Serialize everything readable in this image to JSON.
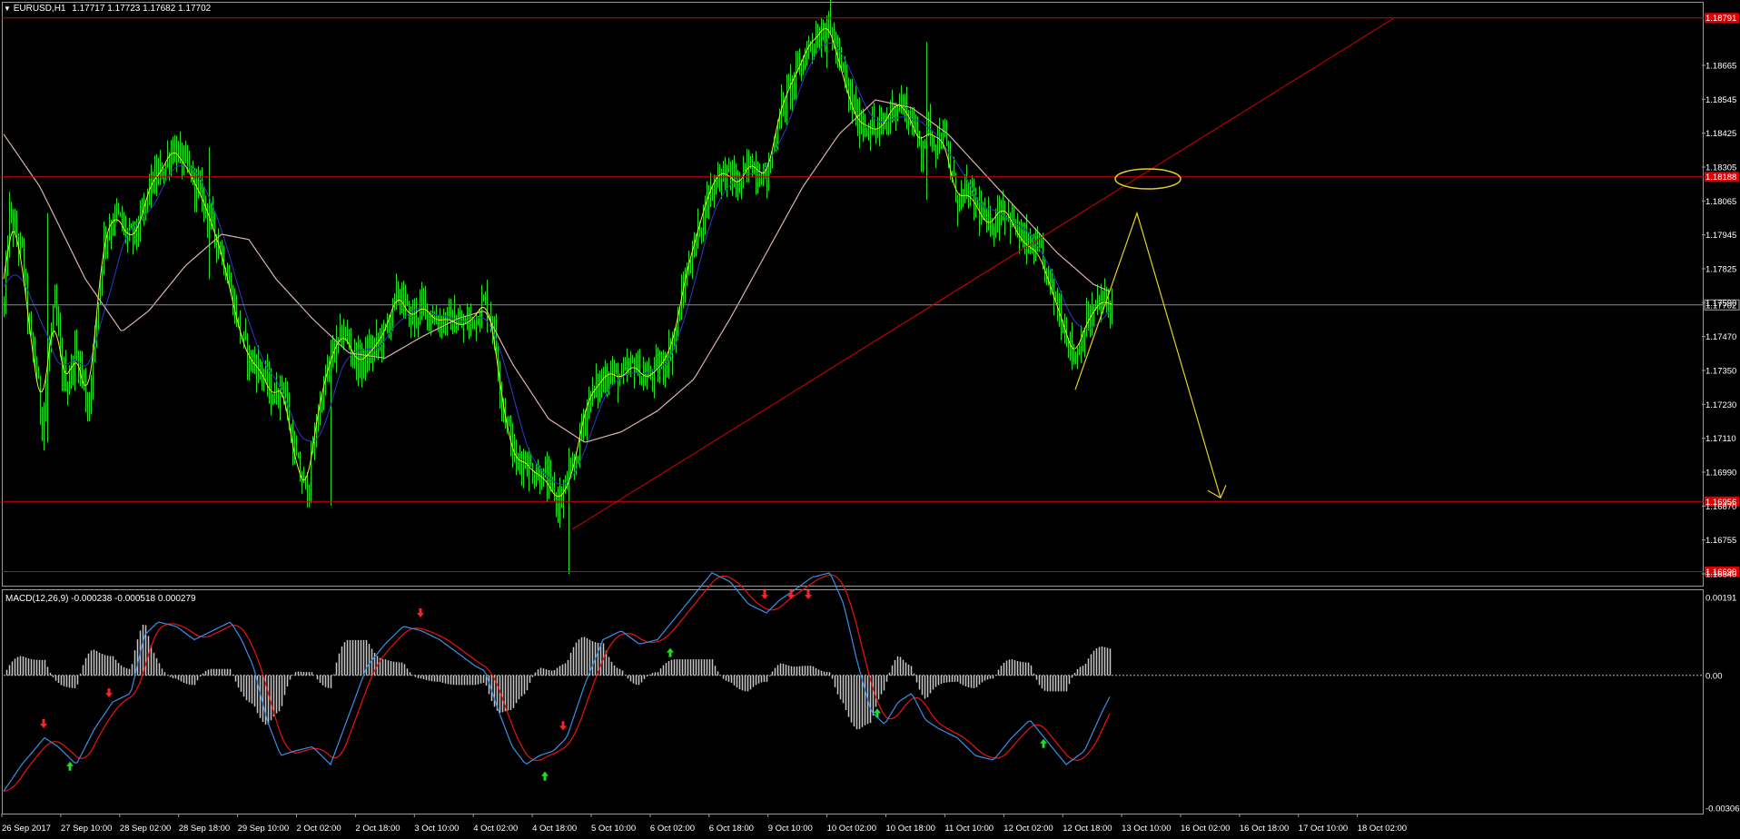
{
  "header": {
    "symbol": "EURUSD,H1",
    "ohlc": "1.17717 1.17723 1.17682 1.17702",
    "macd_label": "MACD(12,26,9) -0.000238 -0.000518 0.000279"
  },
  "colors": {
    "background": "#000000",
    "candles": "#22dd22",
    "fast_ma": "#f2ea3a",
    "mid_ma": "#2b3bcc",
    "slow_ma": "#d9b3a8",
    "levels": "#dd0000",
    "annotation": "#e6d21a",
    "macd_line": "#3b8eea",
    "signal_line": "#ee1111",
    "histogram": "#c8c8c8",
    "buy_arrow": "#22dd22",
    "sell_arrow": "#ff2222"
  },
  "chart_data": [
    {
      "type": "candlestick",
      "title": "EURUSD,H1",
      "ylim": [
        1.1664,
        1.1879
      ],
      "price_ticks": [
        "1.18665",
        "1.18545",
        "1.18425",
        "1.18305",
        "1.18065",
        "1.17945",
        "1.17825",
        "1.17590",
        "1.17470",
        "1.17350",
        "1.17230",
        "1.17110",
        "1.16990",
        "1.16870",
        "1.16755",
        "1.16640"
      ],
      "time_labels": [
        "26 Sep 2017",
        "27 Sep 10:00",
        "28 Sep 02:00",
        "28 Sep 18:00",
        "29 Sep 10:00",
        "2 Oct 02:00",
        "2 Oct 18:00",
        "3 Oct 10:00",
        "4 Oct 02:00",
        "4 Oct 18:00",
        "5 Oct 10:00",
        "6 Oct 02:00",
        "6 Oct 18:00",
        "9 Oct 10:00",
        "10 Oct 02:00",
        "10 Oct 18:00",
        "11 Oct 10:00",
        "12 Oct 02:00",
        "12 Oct 18:00",
        "13 Oct 10:00",
        "16 Oct 02:00",
        "16 Oct 18:00",
        "17 Oct 10:00",
        "18 Oct 02:00"
      ],
      "price_path": [
        [
          0,
          1.177
        ],
        [
          6,
          1.1805
        ],
        [
          14,
          1.1795
        ],
        [
          20,
          1.179
        ],
        [
          28,
          1.176
        ],
        [
          36,
          1.1745
        ],
        [
          42,
          1.1725
        ],
        [
          50,
          1.1755
        ],
        [
          56,
          1.177
        ],
        [
          64,
          1.1745
        ],
        [
          70,
          1.174
        ],
        [
          78,
          1.1752
        ],
        [
          86,
          1.1745
        ],
        [
          92,
          1.173
        ],
        [
          98,
          1.175
        ],
        [
          110,
          1.1795
        ],
        [
          124,
          1.1805
        ],
        [
          138,
          1.1795
        ],
        [
          150,
          1.18
        ],
        [
          160,
          1.1815
        ],
        [
          176,
          1.1822
        ],
        [
          186,
          1.183
        ],
        [
          196,
          1.1825
        ],
        [
          206,
          1.182
        ],
        [
          212,
          1.1815
        ],
        [
          220,
          1.181
        ],
        [
          230,
          1.18
        ],
        [
          240,
          1.179
        ],
        [
          250,
          1.1775
        ],
        [
          260,
          1.176
        ],
        [
          270,
          1.175
        ],
        [
          284,
          1.1745
        ],
        [
          296,
          1.1735
        ],
        [
          308,
          1.174
        ],
        [
          316,
          1.172
        ],
        [
          326,
          1.1705
        ],
        [
          334,
          1.17
        ],
        [
          346,
          1.173
        ],
        [
          360,
          1.175
        ],
        [
          374,
          1.176
        ],
        [
          390,
          1.1748
        ],
        [
          404,
          1.1752
        ],
        [
          420,
          1.176
        ],
        [
          434,
          1.1775
        ],
        [
          448,
          1.1765
        ],
        [
          462,
          1.177
        ],
        [
          476,
          1.1764
        ],
        [
          490,
          1.1765
        ],
        [
          504,
          1.1762
        ],
        [
          518,
          1.1765
        ],
        [
          530,
          1.1772
        ],
        [
          540,
          1.176
        ],
        [
          548,
          1.1735
        ],
        [
          556,
          1.1722
        ],
        [
          564,
          1.171
        ],
        [
          572,
          1.1712
        ],
        [
          582,
          1.1707
        ],
        [
          594,
          1.1705
        ],
        [
          604,
          1.17
        ],
        [
          610,
          1.1695
        ],
        [
          618,
          1.17
        ],
        [
          626,
          1.1705
        ],
        [
          634,
          1.172
        ],
        [
          644,
          1.1735
        ],
        [
          656,
          1.174
        ],
        [
          666,
          1.1745
        ],
        [
          680,
          1.1742
        ],
        [
          694,
          1.1748
        ],
        [
          706,
          1.1742
        ],
        [
          718,
          1.1745
        ],
        [
          730,
          1.175
        ],
        [
          740,
          1.176
        ],
        [
          750,
          1.178
        ],
        [
          762,
          1.1795
        ],
        [
          774,
          1.181
        ],
        [
          786,
          1.182
        ],
        [
          798,
          1.182
        ],
        [
          810,
          1.1815
        ],
        [
          822,
          1.1825
        ],
        [
          832,
          1.182
        ],
        [
          842,
          1.182
        ],
        [
          852,
          1.184
        ],
        [
          864,
          1.1852
        ],
        [
          876,
          1.186
        ],
        [
          888,
          1.187
        ],
        [
          898,
          1.1872
        ],
        [
          906,
          1.1878
        ],
        [
          914,
          1.187
        ],
        [
          922,
          1.186
        ],
        [
          930,
          1.185
        ],
        [
          940,
          1.184
        ],
        [
          952,
          1.1838
        ],
        [
          962,
          1.1836
        ],
        [
          972,
          1.184
        ],
        [
          982,
          1.1847
        ],
        [
          992,
          1.1845
        ],
        [
          1002,
          1.1838
        ],
        [
          1010,
          1.183
        ],
        [
          1018,
          1.1838
        ],
        [
          1026,
          1.1832
        ],
        [
          1034,
          1.1835
        ],
        [
          1042,
          1.1822
        ],
        [
          1050,
          1.181
        ],
        [
          1060,
          1.1813
        ],
        [
          1072,
          1.1808
        ],
        [
          1082,
          1.18
        ],
        [
          1092,
          1.1803
        ],
        [
          1100,
          1.1808
        ],
        [
          1110,
          1.1802
        ],
        [
          1120,
          1.1795
        ],
        [
          1130,
          1.1792
        ],
        [
          1140,
          1.179
        ],
        [
          1150,
          1.178
        ],
        [
          1160,
          1.177
        ],
        [
          1168,
          1.1762
        ],
        [
          1174,
          1.1755
        ],
        [
          1180,
          1.175
        ],
        [
          1188,
          1.176
        ],
        [
          1196,
          1.1765
        ],
        [
          1204,
          1.177
        ],
        [
          1212,
          1.1772
        ],
        [
          1220,
          1.177
        ]
      ],
      "moving_averages": {
        "slow_path": [
          [
            0,
            1.1835
          ],
          [
            40,
            1.1815
          ],
          [
            90,
            1.178
          ],
          [
            130,
            1.176
          ],
          [
            160,
            1.1768
          ],
          [
            200,
            1.1785
          ],
          [
            240,
            1.1797
          ],
          [
            270,
            1.1795
          ],
          [
            300,
            1.178
          ],
          [
            340,
            1.1765
          ],
          [
            380,
            1.1752
          ],
          [
            420,
            1.175
          ],
          [
            460,
            1.1758
          ],
          [
            500,
            1.1765
          ],
          [
            530,
            1.1768
          ],
          [
            560,
            1.1748
          ],
          [
            600,
            1.1727
          ],
          [
            640,
            1.1718
          ],
          [
            680,
            1.1722
          ],
          [
            720,
            1.173
          ],
          [
            760,
            1.1742
          ],
          [
            800,
            1.1765
          ],
          [
            840,
            1.179
          ],
          [
            880,
            1.1815
          ],
          [
            920,
            1.1835
          ],
          [
            960,
            1.1848
          ],
          [
            1000,
            1.1845
          ],
          [
            1040,
            1.1835
          ],
          [
            1080,
            1.182
          ],
          [
            1120,
            1.1805
          ],
          [
            1160,
            1.179
          ],
          [
            1200,
            1.1778
          ],
          [
            1220,
            1.1775
          ]
        ]
      },
      "horizontal_levels": [
        {
          "price": 1.18791,
          "tag": "1.18791"
        },
        {
          "price": 1.18188,
          "tag": "1.18188"
        },
        {
          "price": 1.17702,
          "tag": "1.17702",
          "current": true
        },
        {
          "price": 1.16956,
          "tag": "1.16956"
        },
        {
          "price": 1.1669,
          "tag": "1.16690"
        }
      ],
      "annotations": {
        "trendline": [
          [
            626,
            1.1685
          ],
          [
            1530,
            1.18788
          ]
        ],
        "zigzag_projection": [
          [
            1180,
            1.1738
          ],
          [
            1248,
            1.1805
          ],
          [
            1340,
            1.1697
          ]
        ],
        "target_ellipse": {
          "center": [
            1260,
            1.1818
          ]
        }
      }
    },
    {
      "type": "macd",
      "title": "MACD(12,26,9) -0.000238 -0.000518 0.000279",
      "ylim": [
        -0.00306,
        0.00191
      ],
      "ticks": [
        "0.00191",
        "0.00",
        "-0.00306"
      ],
      "macd_path": [
        [
          0,
          -0.0026
        ],
        [
          20,
          -0.002
        ],
        [
          45,
          -0.0014
        ],
        [
          60,
          -0.0016
        ],
        [
          80,
          -0.002
        ],
        [
          100,
          -0.0012
        ],
        [
          120,
          -0.0006
        ],
        [
          140,
          -0.0004
        ],
        [
          155,
          0.0009
        ],
        [
          170,
          0.0012
        ],
        [
          190,
          0.0011
        ],
        [
          210,
          0.0008
        ],
        [
          230,
          0.001
        ],
        [
          250,
          0.0012
        ],
        [
          262,
          0.0008
        ],
        [
          275,
          0.0002
        ],
        [
          290,
          -0.001
        ],
        [
          305,
          -0.0018
        ],
        [
          320,
          -0.0017
        ],
        [
          340,
          -0.0016
        ],
        [
          360,
          -0.002
        ],
        [
          380,
          -0.0009
        ],
        [
          400,
          0.0002
        ],
        [
          420,
          0.0007
        ],
        [
          440,
          0.0011
        ],
        [
          460,
          0.001
        ],
        [
          480,
          0.0008
        ],
        [
          500,
          0.0005
        ],
        [
          520,
          0.0002
        ],
        [
          530,
          0.0001
        ],
        [
          545,
          -0.0008
        ],
        [
          560,
          -0.0016
        ],
        [
          575,
          -0.002
        ],
        [
          590,
          -0.0018
        ],
        [
          605,
          -0.0017
        ],
        [
          620,
          -0.0014
        ],
        [
          640,
          -0.0002
        ],
        [
          660,
          0.0008
        ],
        [
          680,
          0.001
        ],
        [
          700,
          0.0007
        ],
        [
          720,
          0.0008
        ],
        [
          740,
          0.0013
        ],
        [
          760,
          0.0018
        ],
        [
          780,
          0.0023
        ],
        [
          800,
          0.0021
        ],
        [
          820,
          0.0016
        ],
        [
          840,
          0.0014
        ],
        [
          855,
          0.0017
        ],
        [
          870,
          0.0019
        ],
        [
          890,
          0.0022
        ],
        [
          910,
          0.0023
        ],
        [
          925,
          0.0016
        ],
        [
          940,
          0.0003
        ],
        [
          955,
          -0.0008
        ],
        [
          970,
          -0.0011
        ],
        [
          985,
          -0.0006
        ],
        [
          1000,
          -0.0004
        ],
        [
          1015,
          -0.001
        ],
        [
          1030,
          -0.0012
        ],
        [
          1050,
          -0.0014
        ],
        [
          1070,
          -0.0018
        ],
        [
          1090,
          -0.0019
        ],
        [
          1110,
          -0.0014
        ],
        [
          1130,
          -0.001
        ],
        [
          1150,
          -0.0015
        ],
        [
          1170,
          -0.002
        ],
        [
          1190,
          -0.0017
        ],
        [
          1210,
          -0.0008
        ],
        [
          1220,
          -0.0004
        ]
      ],
      "histogram_range": [
        0,
        1220
      ]
    }
  ]
}
